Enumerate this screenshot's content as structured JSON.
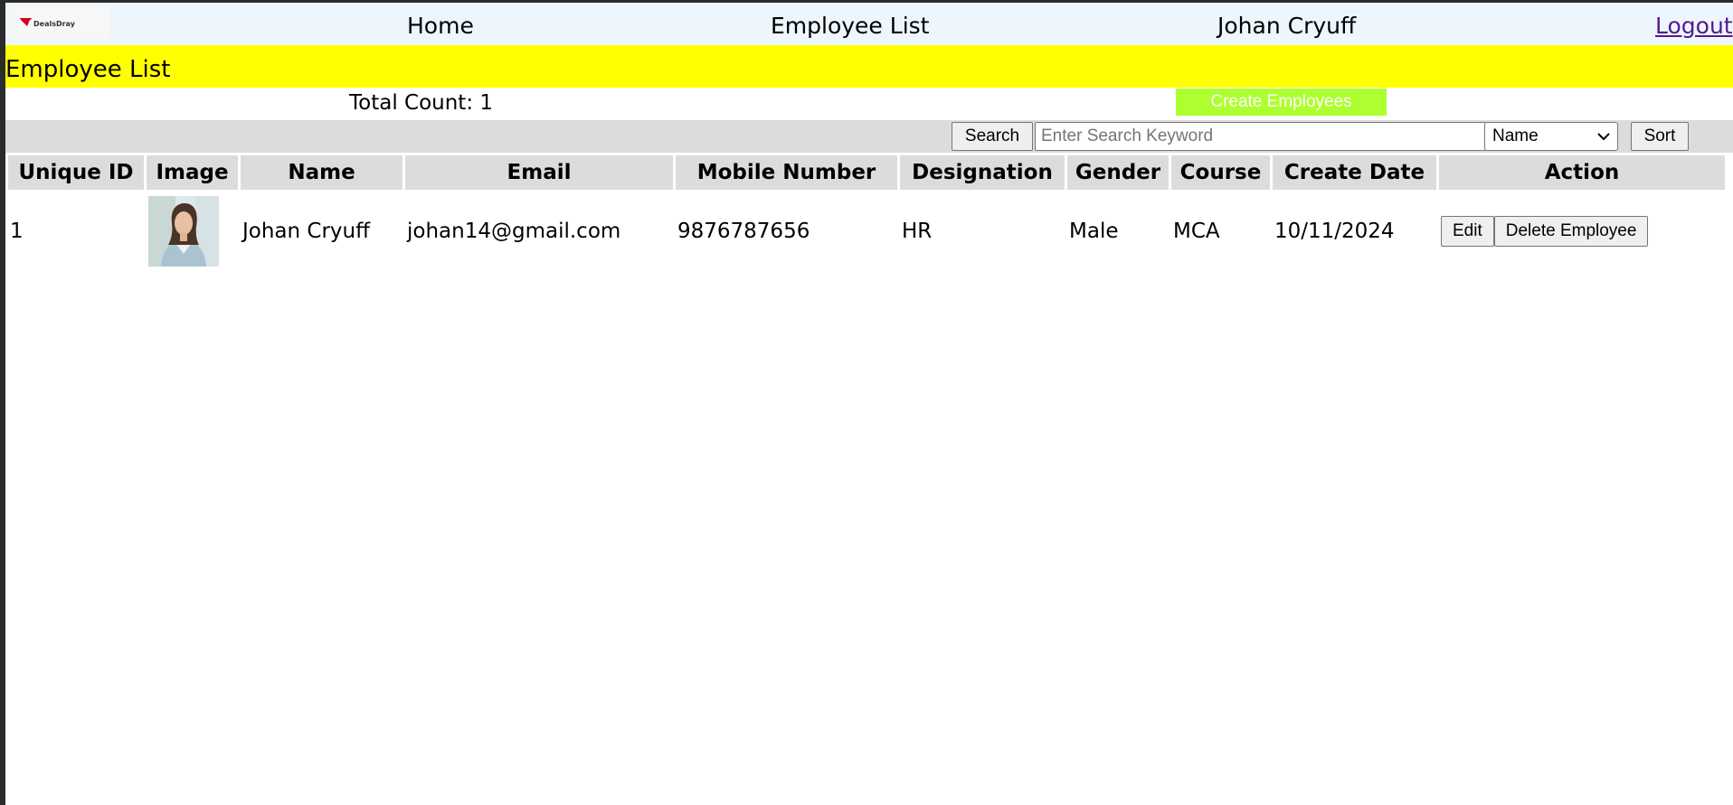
{
  "navbar": {
    "logo_text": "DealsDray",
    "home": "Home",
    "employee_list": "Employee List",
    "user_name": "Johan Cryuff",
    "logout": "Logout"
  },
  "page": {
    "title": "Employee List",
    "total_label": "Total Count: ",
    "total_value": "1",
    "create_button": "Create Employees"
  },
  "toolbar": {
    "search_button": "Search",
    "search_placeholder": "Enter Search Keyword",
    "sort_selected": "Name",
    "sort_button": "Sort"
  },
  "table": {
    "headers": [
      "Unique ID",
      "Image",
      "Name",
      "Email",
      "Mobile Number",
      "Designation",
      "Gender",
      "Course",
      "Create Date",
      "Action"
    ],
    "rows": [
      {
        "id": "1",
        "name": "Johan Cryuff",
        "email": "johan14@gmail.com",
        "mobile": "9876787656",
        "designation": "HR",
        "gender": "Male",
        "course": "MCA",
        "create_date": "10/11/2024",
        "edit_label": "Edit",
        "delete_label": "Delete Employee"
      }
    ]
  },
  "colors": {
    "title_bar": "#ffff00",
    "create_button": "#adff2f",
    "navbar": "#eef6fd",
    "header_cell": "#dcdcdc"
  }
}
